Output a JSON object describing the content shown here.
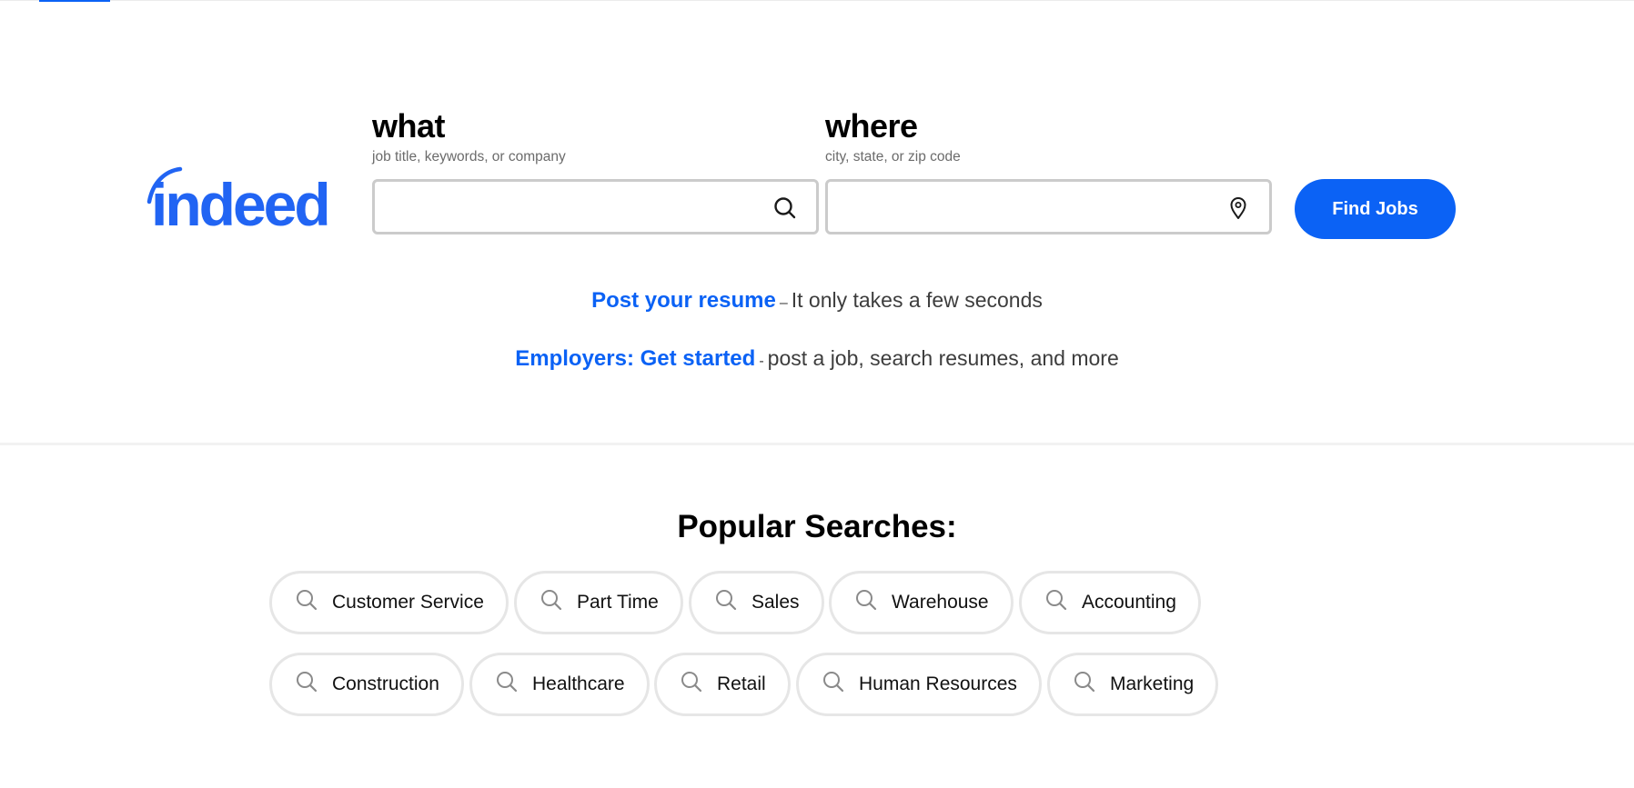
{
  "brand": {
    "name": "indeed",
    "accent": "#0b62f5",
    "logo_color": "#2164f3"
  },
  "search": {
    "what": {
      "label": "what",
      "help": "job title, keywords, or company",
      "value": "",
      "placeholder": "",
      "icon": "search-icon"
    },
    "where": {
      "label": "where",
      "help": "city, state, or zip code",
      "value": "",
      "placeholder": "",
      "icon": "location-pin-icon"
    },
    "submit_label": "Find Jobs"
  },
  "promos": [
    {
      "link": "Post your resume",
      "separator": "–",
      "text": "It only takes a few seconds"
    },
    {
      "link": "Employers: Get started",
      "separator": "-",
      "text": "post a job, search resumes, and more"
    }
  ],
  "popular": {
    "title": "Popular Searches:",
    "rows": [
      [
        "Customer Service",
        "Part Time",
        "Sales",
        "Warehouse",
        "Accounting"
      ],
      [
        "Construction",
        "Healthcare",
        "Retail",
        "Human Resources",
        "Marketing"
      ]
    ]
  }
}
